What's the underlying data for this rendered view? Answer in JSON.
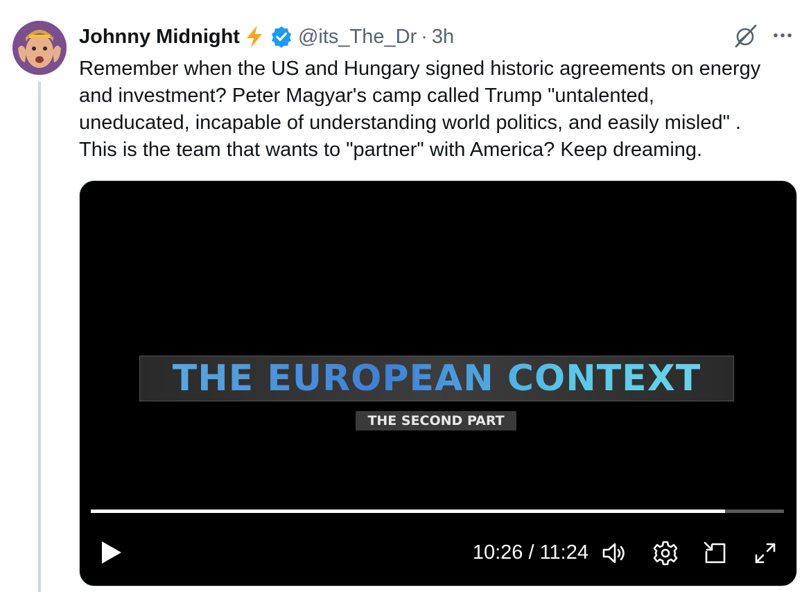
{
  "tweet": {
    "author_name": "Johnny Midnight",
    "handle": "@its_The_Dr",
    "separator": "·",
    "time": "3h",
    "text": "Remember when the US and Hungary signed historic agreements on energy\nand investment? Peter Magyar's camp called Trump \"untalented,\nuneducated, incapable of understanding world politics, and easily misled\" .\nThis is the team that wants to \"partner\" with America? Keep dreaming."
  },
  "icons": {
    "bolt": "lightning-bolt-emoji",
    "verified": "verified-badge-icon",
    "grok": "grok-icon",
    "more": "more-icon"
  },
  "video": {
    "frame_title": "THE EUROPEAN CONTEXT",
    "frame_subtitle": "THE SECOND PART",
    "current_time": "10:26",
    "duration": "11:24",
    "time_display": "10:26 / 11:24",
    "progress": 0.915,
    "controls": [
      "play-icon",
      "volume-icon",
      "settings-icon",
      "picture-in-picture-icon",
      "fullscreen-icon"
    ]
  },
  "colors": {
    "verified": "#1d9bf0",
    "bolt": "#f7a626",
    "secondary_text": "#536471",
    "thread_line": "#cfd9de"
  }
}
